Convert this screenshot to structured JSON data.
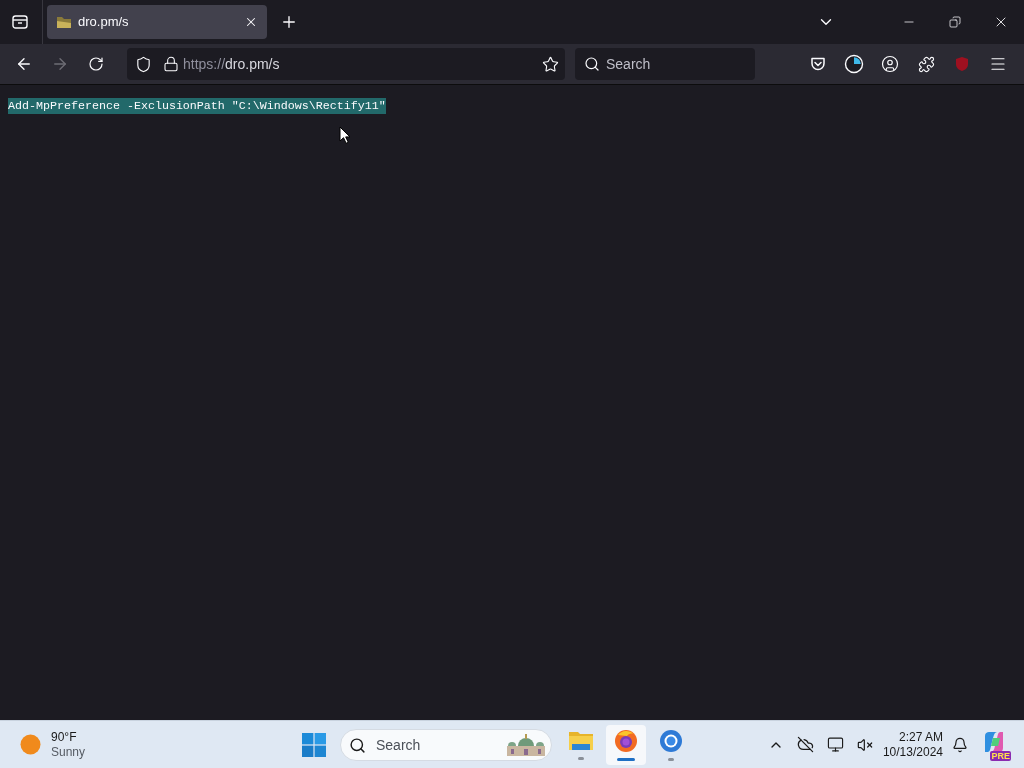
{
  "browser": {
    "tabs": [
      {
        "title": "dro.pm/s",
        "selected": true
      }
    ],
    "url": {
      "scheme": "https://",
      "rest": "dro.pm/s"
    },
    "search": {
      "placeholder": "Search"
    }
  },
  "page": {
    "text": "Add-MpPreference -ExclusionPath \"C:\\Windows\\Rectify11\"",
    "selected": true
  },
  "taskbar": {
    "weather": {
      "temperature": "90°F",
      "condition": "Sunny"
    },
    "search": {
      "placeholder": "Search"
    },
    "apps": [
      {
        "kind": "files",
        "selected": false
      },
      {
        "kind": "firefox",
        "selected": true
      },
      {
        "kind": "chrome",
        "selected": false
      }
    ],
    "time": "2:27 AM",
    "date": "10/13/2024",
    "copilot_badge": "PRE"
  }
}
